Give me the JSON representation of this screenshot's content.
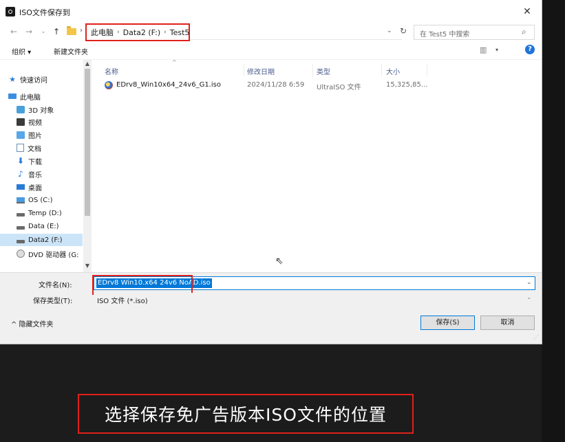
{
  "window": {
    "title": "ISO文件保存到",
    "close": "✕"
  },
  "nav": {
    "back": "←",
    "forward": "→",
    "dropdown": "⌄",
    "up": "↑",
    "sep": "›",
    "breadcrumb": [
      "此电脑",
      "Data2 (F:)",
      "Test5"
    ],
    "breadcrumb_sep": "›",
    "addr_dropdown": "⌄",
    "refresh": "↻",
    "search_placeholder": "在 Test5 中搜索",
    "search_glyph": "⌕"
  },
  "toolbar": {
    "organize": "组织 ▾",
    "new_folder": "新建文件夹",
    "view_glyph": "▥",
    "view_drop": "▾",
    "help": "?"
  },
  "sidebar": {
    "items": [
      {
        "label": "快速访问",
        "icon": "★"
      },
      {
        "label": "此电脑"
      },
      {
        "label": "3D 对象"
      },
      {
        "label": "视频"
      },
      {
        "label": "图片"
      },
      {
        "label": "文档"
      },
      {
        "label": "下载",
        "icon": "⬇"
      },
      {
        "label": "音乐",
        "icon": "♪"
      },
      {
        "label": "桌面"
      },
      {
        "label": "OS (C:)"
      },
      {
        "label": "Temp (D:)"
      },
      {
        "label": "Data (E:)"
      },
      {
        "label": "Data2 (F:)"
      },
      {
        "label": "DVD 驱动器 (G:"
      }
    ],
    "scroll_up": "▲",
    "scroll_down": "▼"
  },
  "file_list": {
    "columns": [
      "名称",
      "修改日期",
      "类型",
      "大小"
    ],
    "sort_glyph": "^",
    "rows": [
      {
        "name": "EDrv8_Win10x64_24v6_G1.iso",
        "modified": "2024/11/28 6:59",
        "type": "UltraISO 文件",
        "size": "15,325,85..."
      }
    ]
  },
  "cursor": "⇖",
  "form": {
    "filename_label": "文件名(N):",
    "filename_value": "EDrv8 Win10.x64 24v6 NoAD.iso",
    "filetype_label": "保存类型(T):",
    "filetype_value": "ISO 文件 (*.iso)",
    "drop": "⌄"
  },
  "footer": {
    "hide_folders": "^ 隐藏文件夹",
    "save": "保存(S)",
    "cancel": "取消",
    "grip": "⋰"
  },
  "caption": "选择保存免广告版本ISO文件的位置"
}
